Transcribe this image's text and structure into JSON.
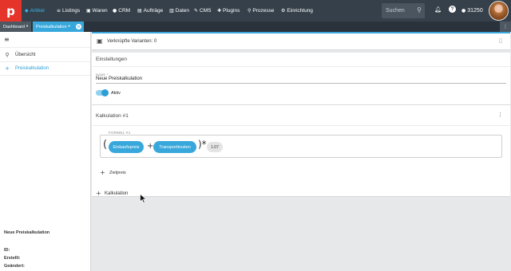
{
  "topbar": {
    "logo": "p",
    "nav": [
      {
        "label": "Artikel",
        "icon": "tag-icon",
        "active": true
      },
      {
        "label": "Listings",
        "icon": "list-icon",
        "active": false
      },
      {
        "label": "Waren",
        "icon": "box-icon",
        "active": false
      },
      {
        "label": "CRM",
        "icon": "people-icon",
        "active": false
      },
      {
        "label": "Aufträge",
        "icon": "cart-icon",
        "active": false
      },
      {
        "label": "Daten",
        "icon": "data-icon",
        "active": false
      },
      {
        "label": "CMS",
        "icon": "cms-icon",
        "active": false
      },
      {
        "label": "Plugins",
        "icon": "puzzle-icon",
        "active": false
      },
      {
        "label": "Prozesse",
        "icon": "process-icon",
        "active": false
      },
      {
        "label": "Einrichtung",
        "icon": "gear-icon",
        "active": false
      }
    ],
    "search_placeholder": "Suchen",
    "user_id": "31250",
    "colors": {
      "bar": "#35404a",
      "logo": "#e5352b",
      "accent": "#38b6e8"
    }
  },
  "tabs": {
    "dashboard": "Dashboard",
    "preiskalkulation": "Preiskalkulation"
  },
  "sidebar": {
    "items": [
      {
        "label": "Übersicht",
        "icon": "search-icon"
      },
      {
        "label": "Preiskalkulation",
        "icon": "plus-icon"
      }
    ],
    "info_title": "Neue Preiskalkulation",
    "info_rows": [
      "ID:",
      "Erstellt:",
      "Geändert:"
    ]
  },
  "main": {
    "variants_label": "Verknüpfte Varianten: 0",
    "settings_title": "Einstellungen",
    "name_label": "NAME *",
    "name_value": "Neue Preiskalkulation",
    "active_label": "Aktiv",
    "active": true,
    "calc_title": "Kalkulation #1",
    "formula_label": "FORMEL #1",
    "formula": {
      "open_paren": "(",
      "chip1": "Einkaufspreis",
      "plus": "+",
      "chip2": "Transportkosten",
      "close_paren_times": ")*",
      "factor": "1.07"
    },
    "target_price": "Zielpreis",
    "add_calculation": "Kalkulation"
  }
}
